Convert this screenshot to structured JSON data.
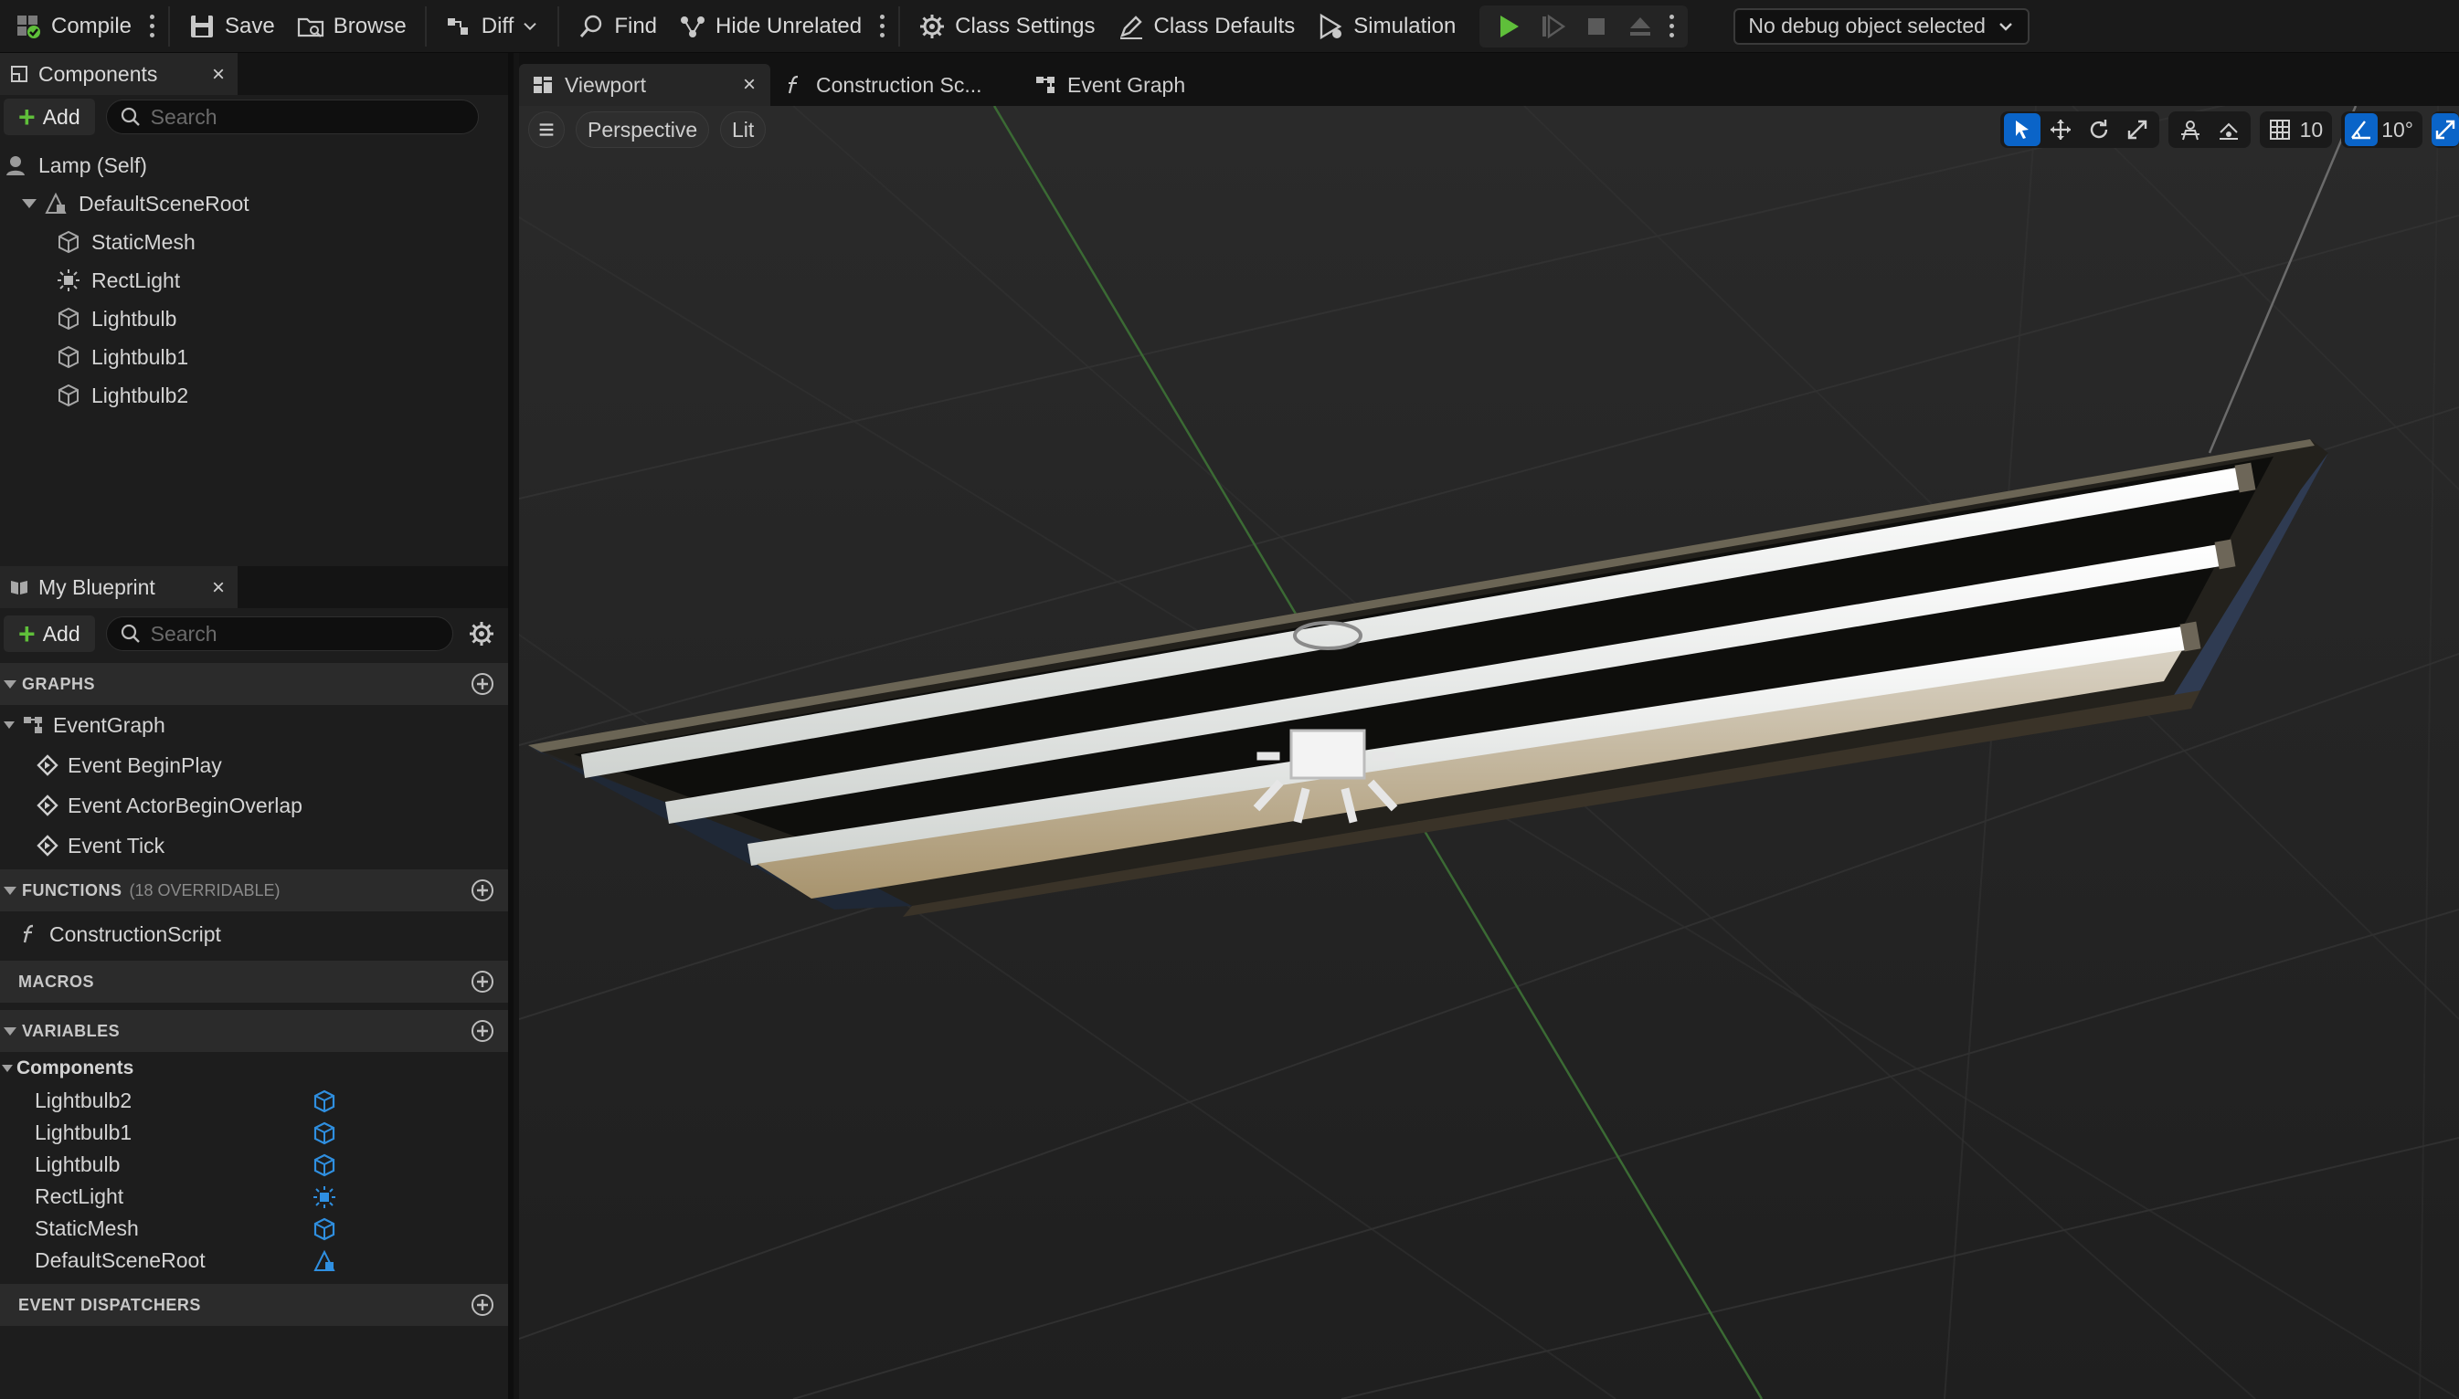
{
  "toolbar": {
    "compile": "Compile",
    "save": "Save",
    "browse": "Browse",
    "diff": "Diff",
    "find": "Find",
    "hide_unrelated": "Hide Unrelated",
    "class_settings": "Class Settings",
    "class_defaults": "Class Defaults",
    "simulation": "Simulation",
    "debug_object": "No debug object selected"
  },
  "components_panel": {
    "title": "Components",
    "add": "Add",
    "search_placeholder": "Search",
    "root": "Lamp (Self)",
    "scene_root": "DefaultSceneRoot",
    "children": [
      "StaticMesh",
      "RectLight",
      "Lightbulb",
      "Lightbulb1",
      "Lightbulb2"
    ]
  },
  "my_blueprint": {
    "title": "My Blueprint",
    "add": "Add",
    "search_placeholder": "Search",
    "graphs": {
      "header": "GRAPHS",
      "event_graph": "EventGraph",
      "events": [
        "Event BeginPlay",
        "Event ActorBeginOverlap",
        "Event Tick"
      ]
    },
    "functions": {
      "header": "FUNCTIONS",
      "note": "(18 OVERRIDABLE)",
      "items": [
        "ConstructionScript"
      ]
    },
    "macros": {
      "header": "MACROS"
    },
    "variables": {
      "header": "VARIABLES",
      "category": "Components",
      "items": [
        "Lightbulb2",
        "Lightbulb1",
        "Lightbulb",
        "RectLight",
        "StaticMesh",
        "DefaultSceneRoot"
      ]
    },
    "event_dispatchers": {
      "header": "EVENT DISPATCHERS"
    }
  },
  "editor_tabs": {
    "viewport": "Viewport",
    "construction": "Construction Sc...",
    "event_graph": "Event Graph"
  },
  "viewport": {
    "perspective": "Perspective",
    "lit": "Lit",
    "grid_snap": "10",
    "rotation_snap": "10°"
  },
  "colors": {
    "accent": "#0a64c8",
    "play_green": "#5fbf3a",
    "icon_blue": "#2f8fe0"
  }
}
